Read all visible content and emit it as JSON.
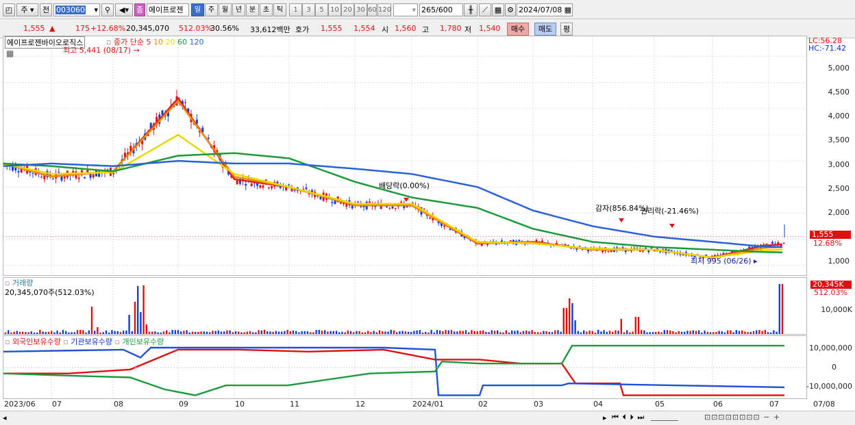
{
  "toolbar": {
    "mode_jo": "주",
    "mode_jeon": "전",
    "code": "003060",
    "name_badge": "종",
    "stock_name": "에이프로젠",
    "periods": [
      "일",
      "주",
      "월",
      "년",
      "분",
      "초",
      "틱"
    ],
    "minute_steps": [
      "1",
      "3",
      "5",
      "10",
      "20",
      "30",
      "60",
      "120"
    ],
    "count": "265",
    "count_total": "/600",
    "date": "2024/07/08"
  },
  "infobar": {
    "price": "1,555",
    "arrow": "▲",
    "change": "175",
    "change_pct": "+12.68%",
    "volume": "20,345,070",
    "volume_pct": "512.03%",
    "turnover": "30.56%",
    "amount": "33,612백만",
    "hoga_label": "호가",
    "ask": "1,555",
    "bid": "1,554",
    "open_label": "시",
    "open": "1,560",
    "high_label": "고",
    "high": "1,780",
    "low_label": "저",
    "low": "1,540",
    "buy_label": "매수",
    "sell_label": "매도",
    "avg_label": "평"
  },
  "price_pane": {
    "stock_label": "에이프로젠바이오로직스",
    "ma_label": "종가 단순",
    "ma_periods": [
      {
        "p": "5",
        "color": "#e02020"
      },
      {
        "p": "10",
        "color": "#f08c00"
      },
      {
        "p": "20",
        "color": "#e8d800"
      },
      {
        "p": "60",
        "color": "#1a9a3a"
      },
      {
        "p": "120",
        "color": "#2a60d8"
      }
    ],
    "lc": "LC:56.28",
    "hc": "HC:-71.42",
    "y_ticks": [
      "5,000",
      "4,500",
      "4,000",
      "3,500",
      "3,000",
      "2,500",
      "2,000",
      "1,500",
      "1,000"
    ],
    "current_price": "1,555",
    "current_pct": "12.68%",
    "high_annot": "최고 5,441 (08/17)",
    "low_annot": "최저 995 (06/26)",
    "events": [
      "배당락(0.00%)",
      "감자(856.84%)",
      "권리락(-21.46%)"
    ]
  },
  "volume_pane": {
    "title": "거래량",
    "value": "20,345,070주(512.03%)",
    "badge": "20,345K",
    "badge_pct": "512.03%",
    "y_tick": "10,000K"
  },
  "holding_pane": {
    "legend": [
      "외국인보유수량",
      "기관보유수량",
      "개인보유수량"
    ],
    "y_ticks": [
      "10,000,000",
      "0",
      "-10,000,000"
    ]
  },
  "x_axis": {
    "labels": [
      "2023/06",
      "07",
      "08",
      "09",
      "10",
      "11",
      "12",
      "2024/01",
      "02",
      "03",
      "04",
      "05",
      "06",
      "07"
    ],
    "right_label": "07/08"
  },
  "chart_data": {
    "type": "line",
    "x": [
      "2023/06",
      "2023/07",
      "2023/08",
      "2023/09",
      "2023/10",
      "2023/11",
      "2023/12",
      "2024/01",
      "2024/02",
      "2024/03",
      "2024/04",
      "2024/05",
      "2024/06",
      "2024/07"
    ],
    "ylim": [
      800,
      5400
    ],
    "series": [
      {
        "name": "5",
        "values": [
          2950,
          2700,
          2800,
          4200,
          2650,
          2500,
          2150,
          2150,
          1420,
          1450,
          1300,
          1300,
          1150,
          1400
        ]
      },
      {
        "name": "10",
        "values": [
          2950,
          2700,
          2800,
          4150,
          2700,
          2500,
          2150,
          2150,
          1430,
          1440,
          1300,
          1300,
          1150,
          1350
        ]
      },
      {
        "name": "20",
        "values": [
          2950,
          2750,
          2780,
          3500,
          2750,
          2500,
          2180,
          2180,
          1450,
          1420,
          1320,
          1300,
          1150,
          1300
        ]
      },
      {
        "name": "60",
        "values": [
          2950,
          2900,
          2800,
          3100,
          3150,
          3050,
          2600,
          2300,
          2100,
          1700,
          1450,
          1350,
          1300,
          1250
        ]
      },
      {
        "name": "120",
        "values": [
          2900,
          2950,
          2900,
          3000,
          2950,
          2950,
          2850,
          2750,
          2500,
          2050,
          1750,
          1550,
          1450,
          1350
        ]
      }
    ]
  }
}
